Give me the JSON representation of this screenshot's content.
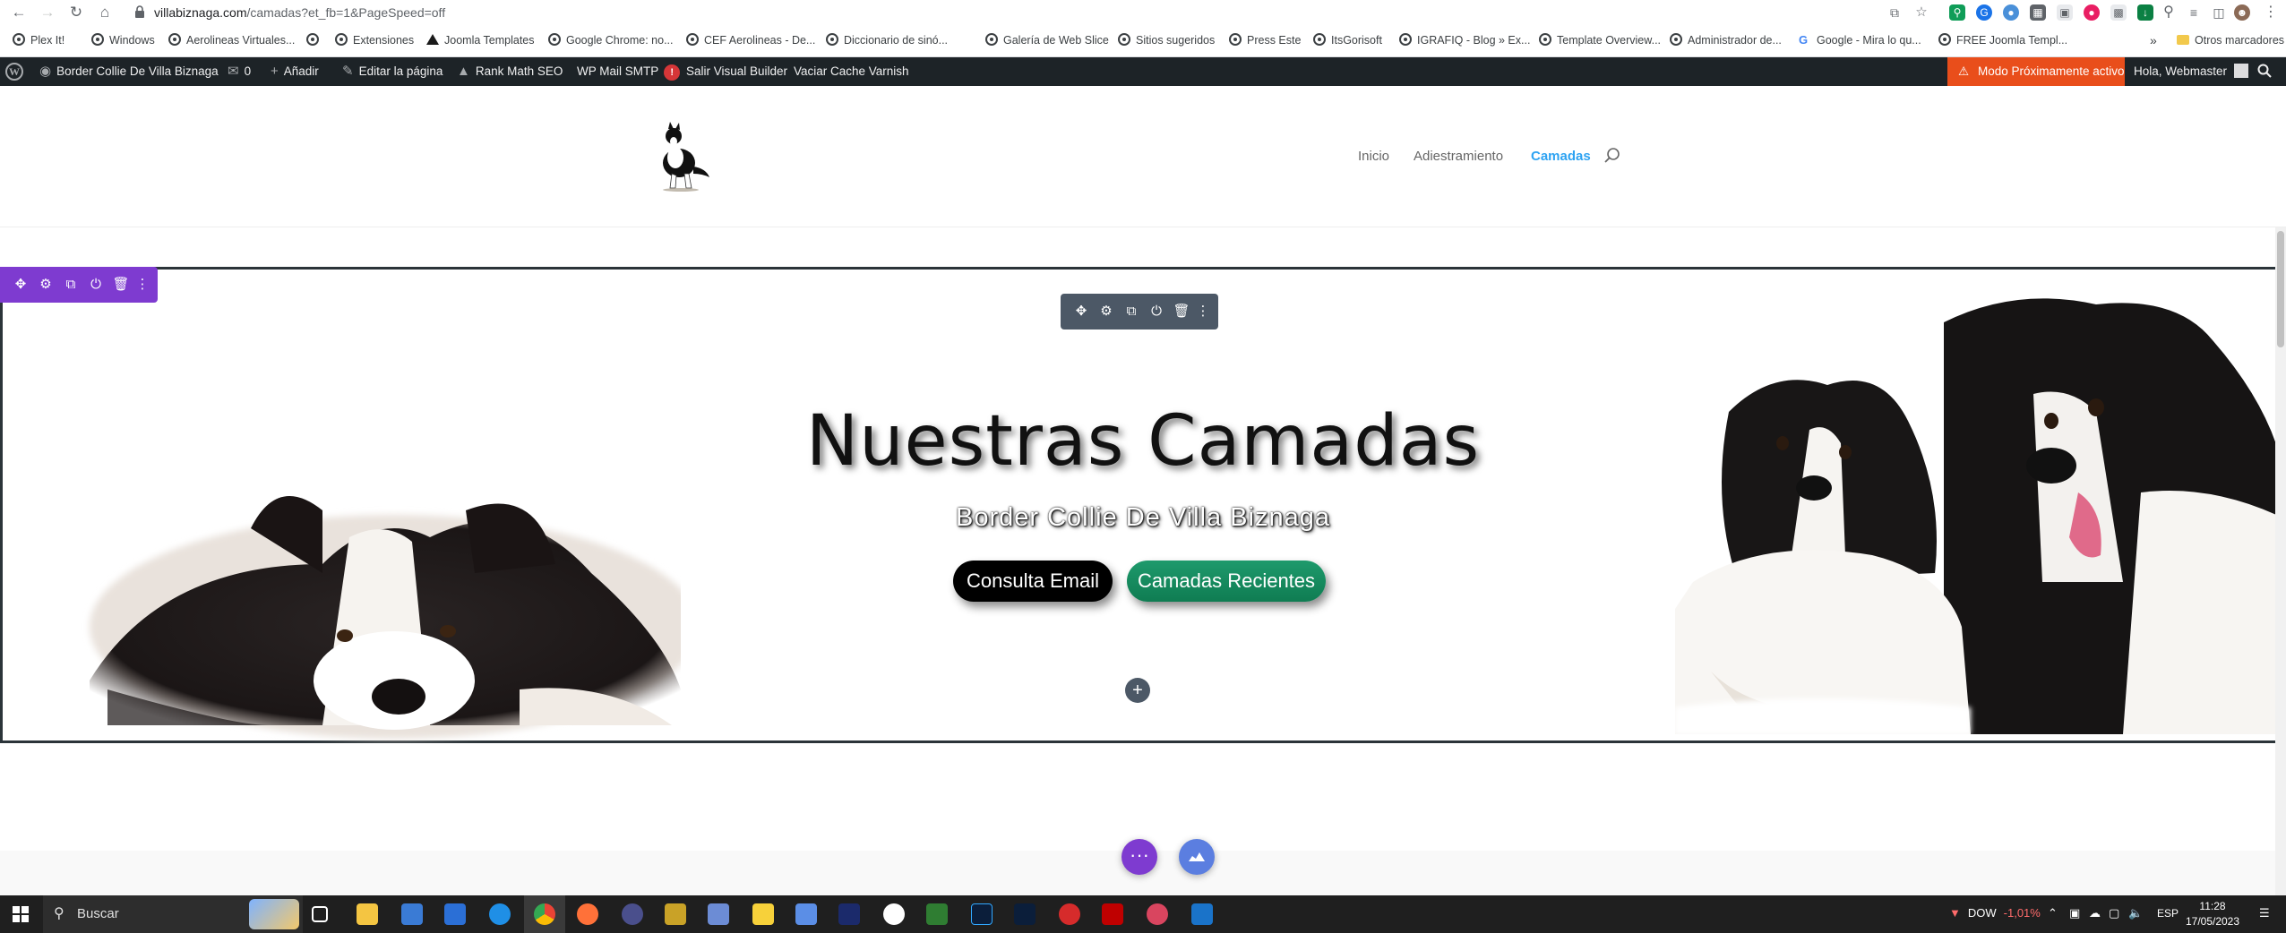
{
  "browser": {
    "url_host": "villabiznaga.com",
    "url_path": "/camadas?et_fb=1&PageSpeed=off",
    "bookmarks": [
      "Plex It!",
      "Windows",
      "Aerolineas Virtuales...",
      "Extensiones",
      "Joomla Templates",
      "Google Chrome: no...",
      "CEF Aerolineas - De...",
      "Diccionario de sinó...",
      "Galería de Web Slice",
      "Sitios sugeridos",
      "Press Este",
      "ItsGorisoft",
      "IGRAFIQ - Blog » Ex...",
      "Template Overview...",
      "Administrador de...",
      "Google - Mira lo qu...",
      "FREE Joomla Templ..."
    ],
    "more_bookmarks": "»",
    "other_bookmarks": "Otros marcadores"
  },
  "wp_admin_bar": {
    "site_name": "Border Collie De Villa Biznaga",
    "comments_count": "0",
    "add_new": "Añadir",
    "edit_page": "Editar la página",
    "rank_math": "Rank Math SEO",
    "wp_mail_smtp": "WP Mail SMTP",
    "smtp_badge": "!",
    "exit_builder": "Salir Visual Builder",
    "purge_varnish": "Vaciar Cache Varnish",
    "coming_soon": "Modo Próximamente activo",
    "greeting": "Hola, Webmaster"
  },
  "site_nav": {
    "items": [
      "Inicio",
      "Adiestramiento",
      "Camadas"
    ],
    "active_index": 2
  },
  "hero": {
    "title": "Nuestras Camadas",
    "subtitle": "Border Collie De Villa Biznaga",
    "button_primary": "Consulta Email",
    "button_secondary": "Camadas Recientes"
  },
  "builder": {
    "add_symbol": "+",
    "dots_symbol": "···"
  },
  "taskbar": {
    "search_placeholder": "Buscar",
    "stock_label": "DOW",
    "stock_change": "-1,01%",
    "language": "ESP",
    "time": "11:28",
    "date": "17/05/2023"
  },
  "colors": {
    "wp_bar": "#1d2327",
    "coming_soon": "#e94e1b",
    "divi_purple": "#7e3bd0",
    "row_toolbar": "#4c5866",
    "nav_active": "#2ea3f2",
    "button_green": "#0f7c52"
  }
}
